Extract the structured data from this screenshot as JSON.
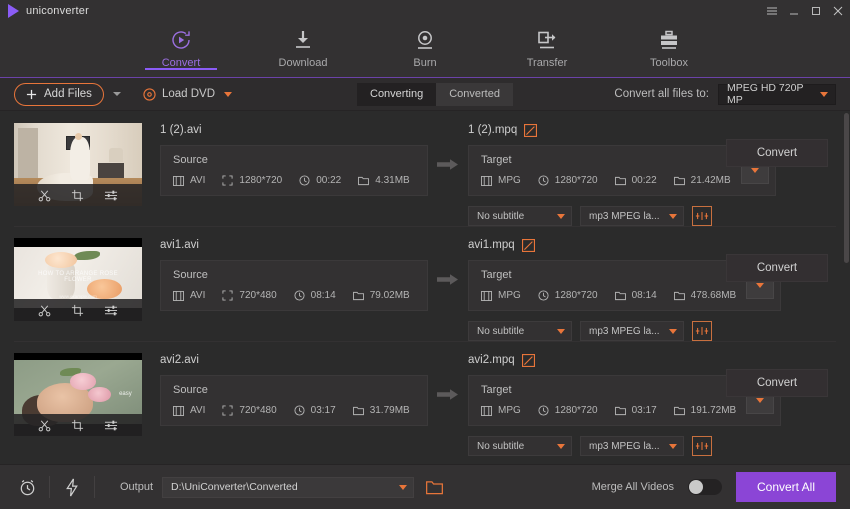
{
  "window": {
    "brand": "uniconverter",
    "controls": [
      {
        "name": "menu-icon",
        "glyph": "menu"
      },
      {
        "name": "minimize-icon",
        "glyph": "minimize"
      },
      {
        "name": "maximize-icon",
        "glyph": "maximize"
      },
      {
        "name": "close-icon",
        "glyph": "close"
      }
    ]
  },
  "nav": {
    "items": [
      {
        "label": "Convert",
        "icon": "convert-icon",
        "active": true
      },
      {
        "label": "Download",
        "icon": "download-icon",
        "active": false
      },
      {
        "label": "Burn",
        "icon": "burn-icon",
        "active": false
      },
      {
        "label": "Transfer",
        "icon": "transfer-icon",
        "active": false
      },
      {
        "label": "Toolbox",
        "icon": "toolbox-icon",
        "active": false
      }
    ]
  },
  "toolbar": {
    "add_files_label": "Add Files",
    "load_dvd_label": "Load DVD",
    "tabs": [
      {
        "label": "Converting",
        "active": true
      },
      {
        "label": "Converted",
        "active": false
      }
    ],
    "convert_all_to_label": "Convert all files to:",
    "output_format": "MPEG HD 720P MP"
  },
  "labels": {
    "source": "Source",
    "target": "Target",
    "convert": "Convert"
  },
  "rows": [
    {
      "thumb": "bride-in-room",
      "source": {
        "filename": "1 (2).avi",
        "format": "AVI",
        "resolution": "1280*720",
        "duration": "00:22",
        "size": "4.31MB"
      },
      "target": {
        "filename": "1 (2).mpq",
        "format": "MPG",
        "resolution": "1280*720",
        "duration": "00:22",
        "size": "21.42MB"
      },
      "subtitle": "No subtitle",
      "audio": "mp3 MPEG la...",
      "convert_label": "Convert"
    },
    {
      "thumb": "roses-in-vase",
      "source": {
        "filename": "avi1.avi",
        "format": "AVI",
        "resolution": "720*480",
        "duration": "08:14",
        "size": "79.02MB"
      },
      "target": {
        "filename": "avi1.mpq",
        "format": "MPG",
        "resolution": "1280*720",
        "duration": "08:14",
        "size": "478.68MB"
      },
      "subtitle": "No subtitle",
      "audio": "mp3 MPEG la...",
      "convert_label": "Convert"
    },
    {
      "thumb": "face-with-roses",
      "source": {
        "filename": "avi2.avi",
        "format": "AVI",
        "resolution": "720*480",
        "duration": "03:17",
        "size": "31.79MB"
      },
      "target": {
        "filename": "avi2.mpq",
        "format": "MPG",
        "resolution": "1280*720",
        "duration": "03:17",
        "size": "191.72MB"
      },
      "subtitle": "No subtitle",
      "audio": "mp3 MPEG la...",
      "convert_label": "Convert"
    }
  ],
  "thumb_tools": [
    "trim-icon",
    "crop-icon",
    "effect-icon"
  ],
  "bottom": {
    "output_label": "Output",
    "output_path": "D:\\UniConverter\\Converted",
    "merge_label": "Merge All Videos",
    "merge_on": false,
    "convert_all_label": "Convert All"
  },
  "colors": {
    "accent_purple": "#8b45d6",
    "accent_orange": "#e8753a",
    "window_bg": "#2b2b2b",
    "panel_bg": "#333132"
  }
}
